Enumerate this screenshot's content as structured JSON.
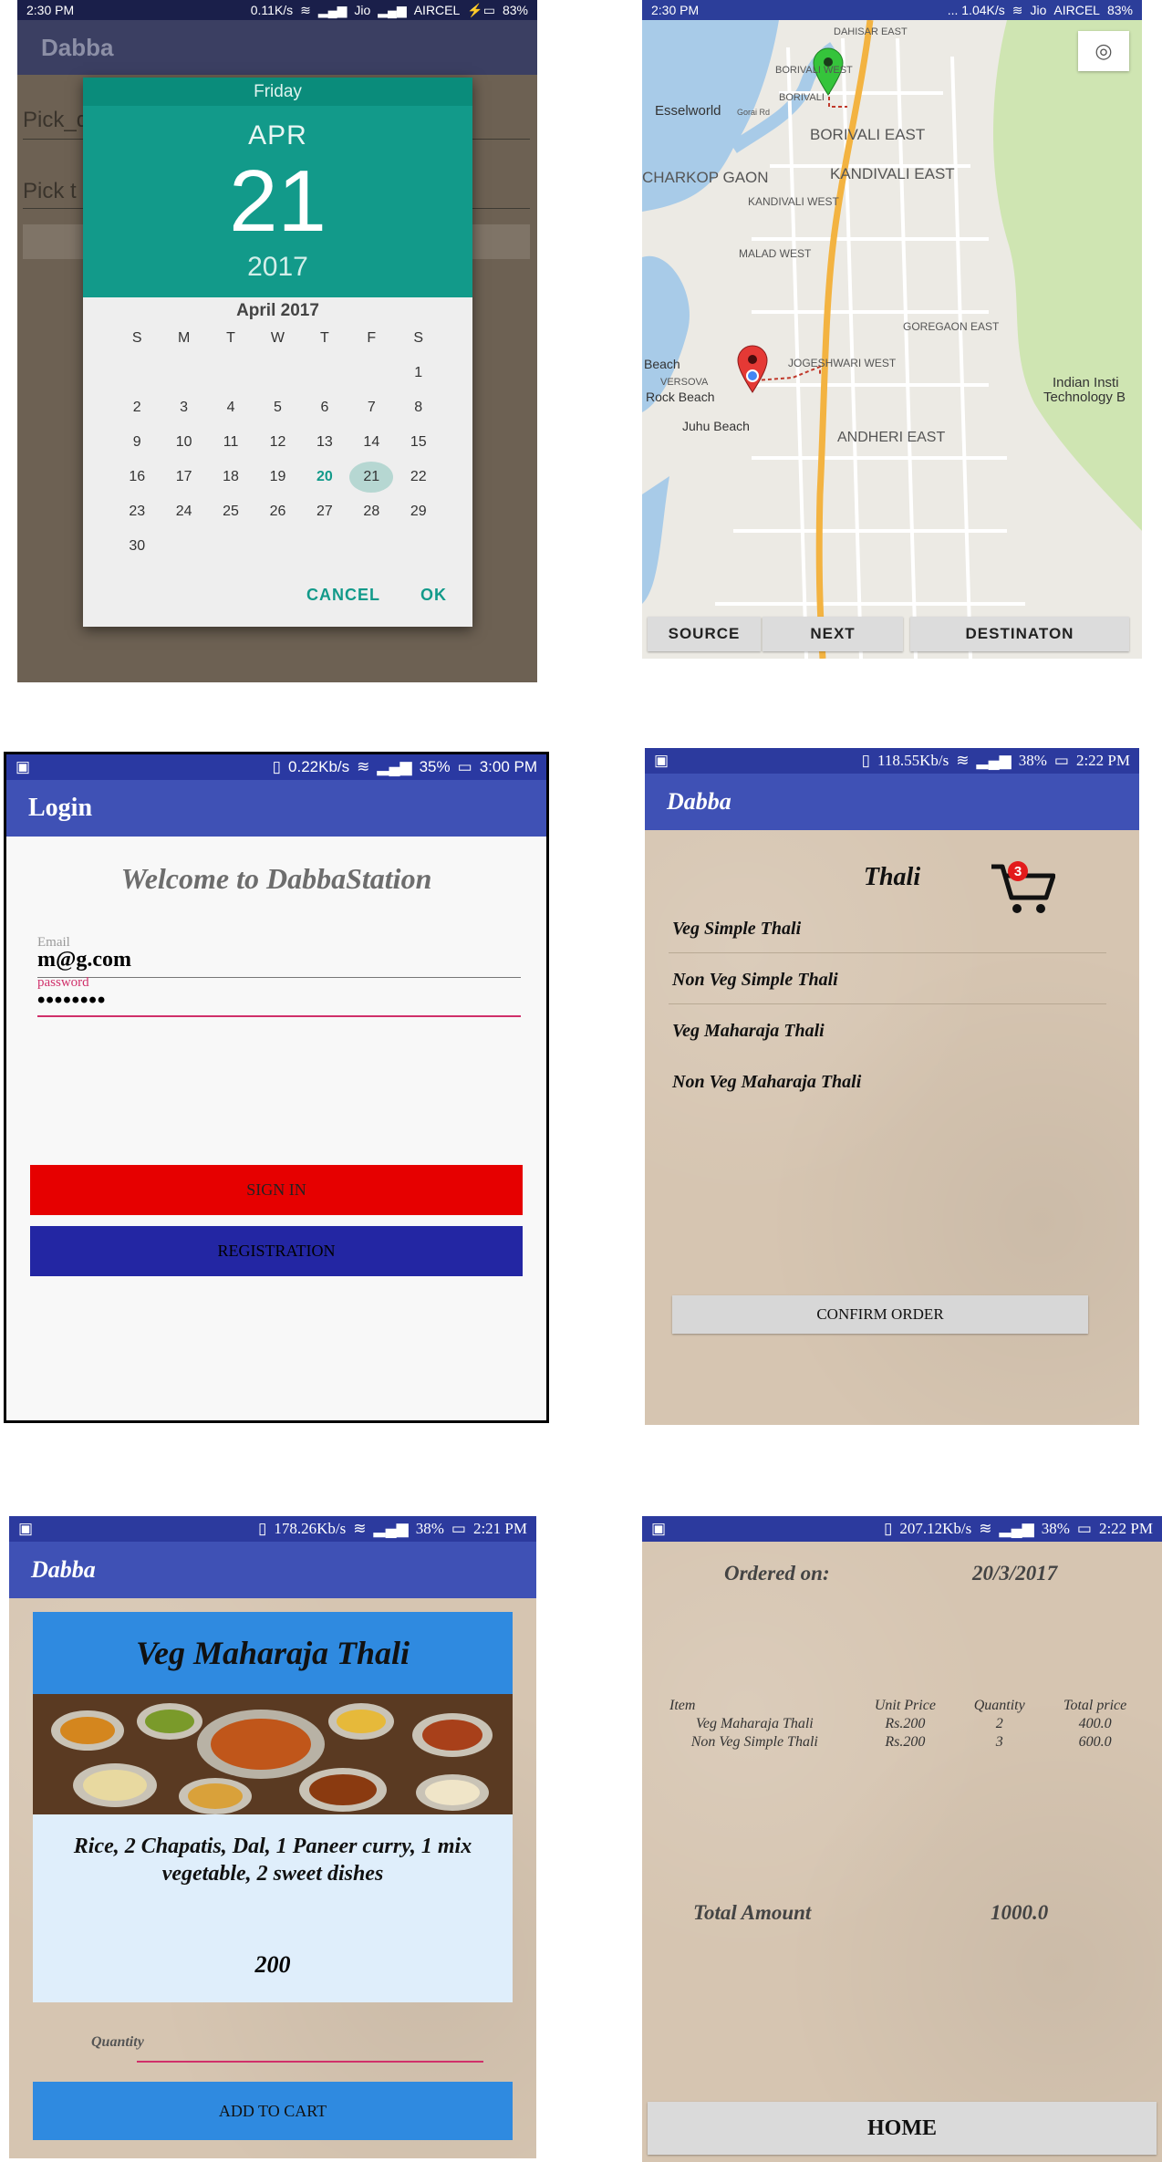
{
  "colors": {
    "teal": "#129a8a",
    "indigo": "#3f51b5",
    "red": "#e60000",
    "navy": "#2326a3",
    "blue": "#2f8ae0",
    "pink": "#d0306a",
    "paper": "#d6c5b1"
  },
  "screen_date": {
    "status": {
      "time": "2:30 PM",
      "speed": "0.11K/s",
      "carrier1": "Jio",
      "carrier2": "AIRCEL",
      "battery": "83%"
    },
    "app_title": "Dabba",
    "bg_field1": "Pick_d",
    "bg_field2": "Pick t",
    "picker": {
      "weekday": "Friday",
      "month": "APR",
      "day": "21",
      "year": "2017",
      "calendar_title": "April 2017",
      "weekdays": [
        "S",
        "M",
        "T",
        "W",
        "T",
        "F",
        "S"
      ],
      "weeks": [
        [
          "",
          "",
          "",
          "",
          "",
          "",
          "1"
        ],
        [
          "2",
          "3",
          "4",
          "5",
          "6",
          "7",
          "8"
        ],
        [
          "9",
          "10",
          "11",
          "12",
          "13",
          "14",
          "15"
        ],
        [
          "16",
          "17",
          "18",
          "19",
          "20",
          "21",
          "22"
        ],
        [
          "23",
          "24",
          "25",
          "26",
          "27",
          "28",
          "29"
        ],
        [
          "30",
          "",
          "",
          "",
          "",
          "",
          ""
        ]
      ],
      "selected": "21",
      "today": "20",
      "cancel": "CANCEL",
      "ok": "OK"
    }
  },
  "screen_map": {
    "status": {
      "time": "2:30 PM",
      "speed": "... 1.04K/s",
      "carrier1": "Jio",
      "carrier2": "AIRCEL",
      "battery": "83%"
    },
    "places": [
      "DAHISAR EAST",
      "BORIVALI WEST",
      "BORIVALI",
      "Esselworld",
      "Gorai Rd",
      "BORIVALI EAST",
      "CHARKOP GAON",
      "KANDIVALI EAST",
      "KANDIVALI WEST",
      "MALAD WEST",
      "GOREGAON EAST",
      "JOGESHWARI WEST",
      "Beach",
      "VERSOVA",
      "Rock Beach",
      "Juhu Beach",
      "ANDHERI EAST",
      "Indian Insti",
      "Technology B"
    ],
    "buttons": {
      "source": "SOURCE",
      "next": "NEXT",
      "destination": "DESTINATON"
    },
    "location_icon": "my-location-icon"
  },
  "screen_login": {
    "status": {
      "speed": "0.22Kb/s",
      "battery": "35%",
      "time": "3:00 PM"
    },
    "title": "Login",
    "welcome": "Welcome to DabbaStation",
    "email_label": "Email",
    "email_value": "m@g.com",
    "password_label": "password",
    "password_value": "••••••••",
    "sign_in": "SIGN IN",
    "registration": "REGISTRATION"
  },
  "screen_menu": {
    "status": {
      "speed": "118.55Kb/s",
      "battery": "38%",
      "time": "2:22 PM"
    },
    "title": "Dabba",
    "heading": "Thali",
    "cart_count": "3",
    "items": [
      "Veg Simple Thali",
      "Non Veg Simple Thali",
      "Veg Maharaja Thali",
      "Non Veg Maharaja Thali"
    ],
    "confirm": "CONFIRM ORDER"
  },
  "screen_detail": {
    "status": {
      "speed": "178.26Kb/s",
      "battery": "38%",
      "time": "2:21 PM"
    },
    "title": "Dabba",
    "dish": "Veg Maharaja Thali",
    "description": "Rice, 2 Chapatis, Dal, 1 Paneer curry, 1 mix vegetable, 2 sweet dishes",
    "price": "200",
    "quantity_label": "Quantity",
    "add_to_cart": "ADD TO CART"
  },
  "screen_order": {
    "status": {
      "speed": "207.12Kb/s",
      "battery": "38%",
      "time": "2:22 PM"
    },
    "ordered_on_label": "Ordered on:",
    "ordered_on": "20/3/2017",
    "columns": [
      "Item",
      "Unit Price",
      "Quantity",
      "Total price"
    ],
    "rows": [
      [
        "Veg Maharaja Thali",
        "Rs.200",
        "2",
        "400.0"
      ],
      [
        "Non Veg Simple Thali",
        "Rs.200",
        "3",
        "600.0"
      ]
    ],
    "total_label": "Total Amount",
    "total_value": "1000.0",
    "home": "HOME"
  }
}
